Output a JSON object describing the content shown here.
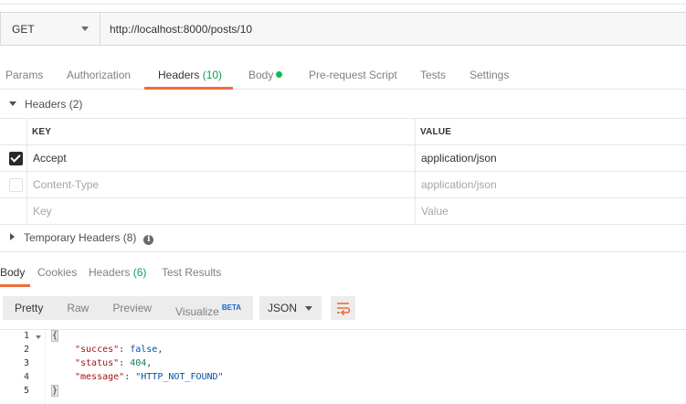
{
  "request": {
    "method": "GET",
    "url": "http://localhost:8000/posts/10"
  },
  "request_tabs": [
    {
      "label": "Params"
    },
    {
      "label": "Authorization"
    },
    {
      "label": "Headers",
      "count": "(10)"
    },
    {
      "label": "Body"
    },
    {
      "label": "Pre-request Script"
    },
    {
      "label": "Tests"
    },
    {
      "label": "Settings"
    }
  ],
  "headers_section": {
    "title": "Headers",
    "count": "(2)",
    "col_key": "KEY",
    "col_value": "VALUE",
    "rows": [
      {
        "key": "Accept",
        "value": "application/json",
        "checked": true
      },
      {
        "key": "Content-Type",
        "value": "application/json",
        "checked": false
      }
    ],
    "placeholder_key": "Key",
    "placeholder_value": "Value"
  },
  "temp_headers": {
    "title": "Temporary Headers",
    "count": "(8)",
    "info_glyph": "i"
  },
  "response_tabs": [
    {
      "label": "Body"
    },
    {
      "label": "Cookies"
    },
    {
      "label": "Headers",
      "count": "(6)"
    },
    {
      "label": "Test Results"
    }
  ],
  "response_toolbar": {
    "modes": [
      "Pretty",
      "Raw",
      "Preview",
      "Visualize"
    ],
    "beta": "BETA",
    "format": "JSON"
  },
  "code": {
    "line_numbers": [
      "1",
      "2",
      "3",
      "4",
      "5"
    ],
    "open_brace": "{",
    "close_brace": "}",
    "lines": [
      {
        "key": "\"succes\"",
        "value": "false",
        "sep": ",",
        "type": "bool"
      },
      {
        "key": "\"status\"",
        "value": "404",
        "sep": ",",
        "type": "num"
      },
      {
        "key": "\"message\"",
        "value": "\"HTTP_NOT_FOUND\"",
        "sep": "",
        "type": "str"
      }
    ]
  },
  "colors": {
    "accent": "#f26b3a",
    "success": "#0cbb52",
    "beta": "#1a66cc"
  }
}
